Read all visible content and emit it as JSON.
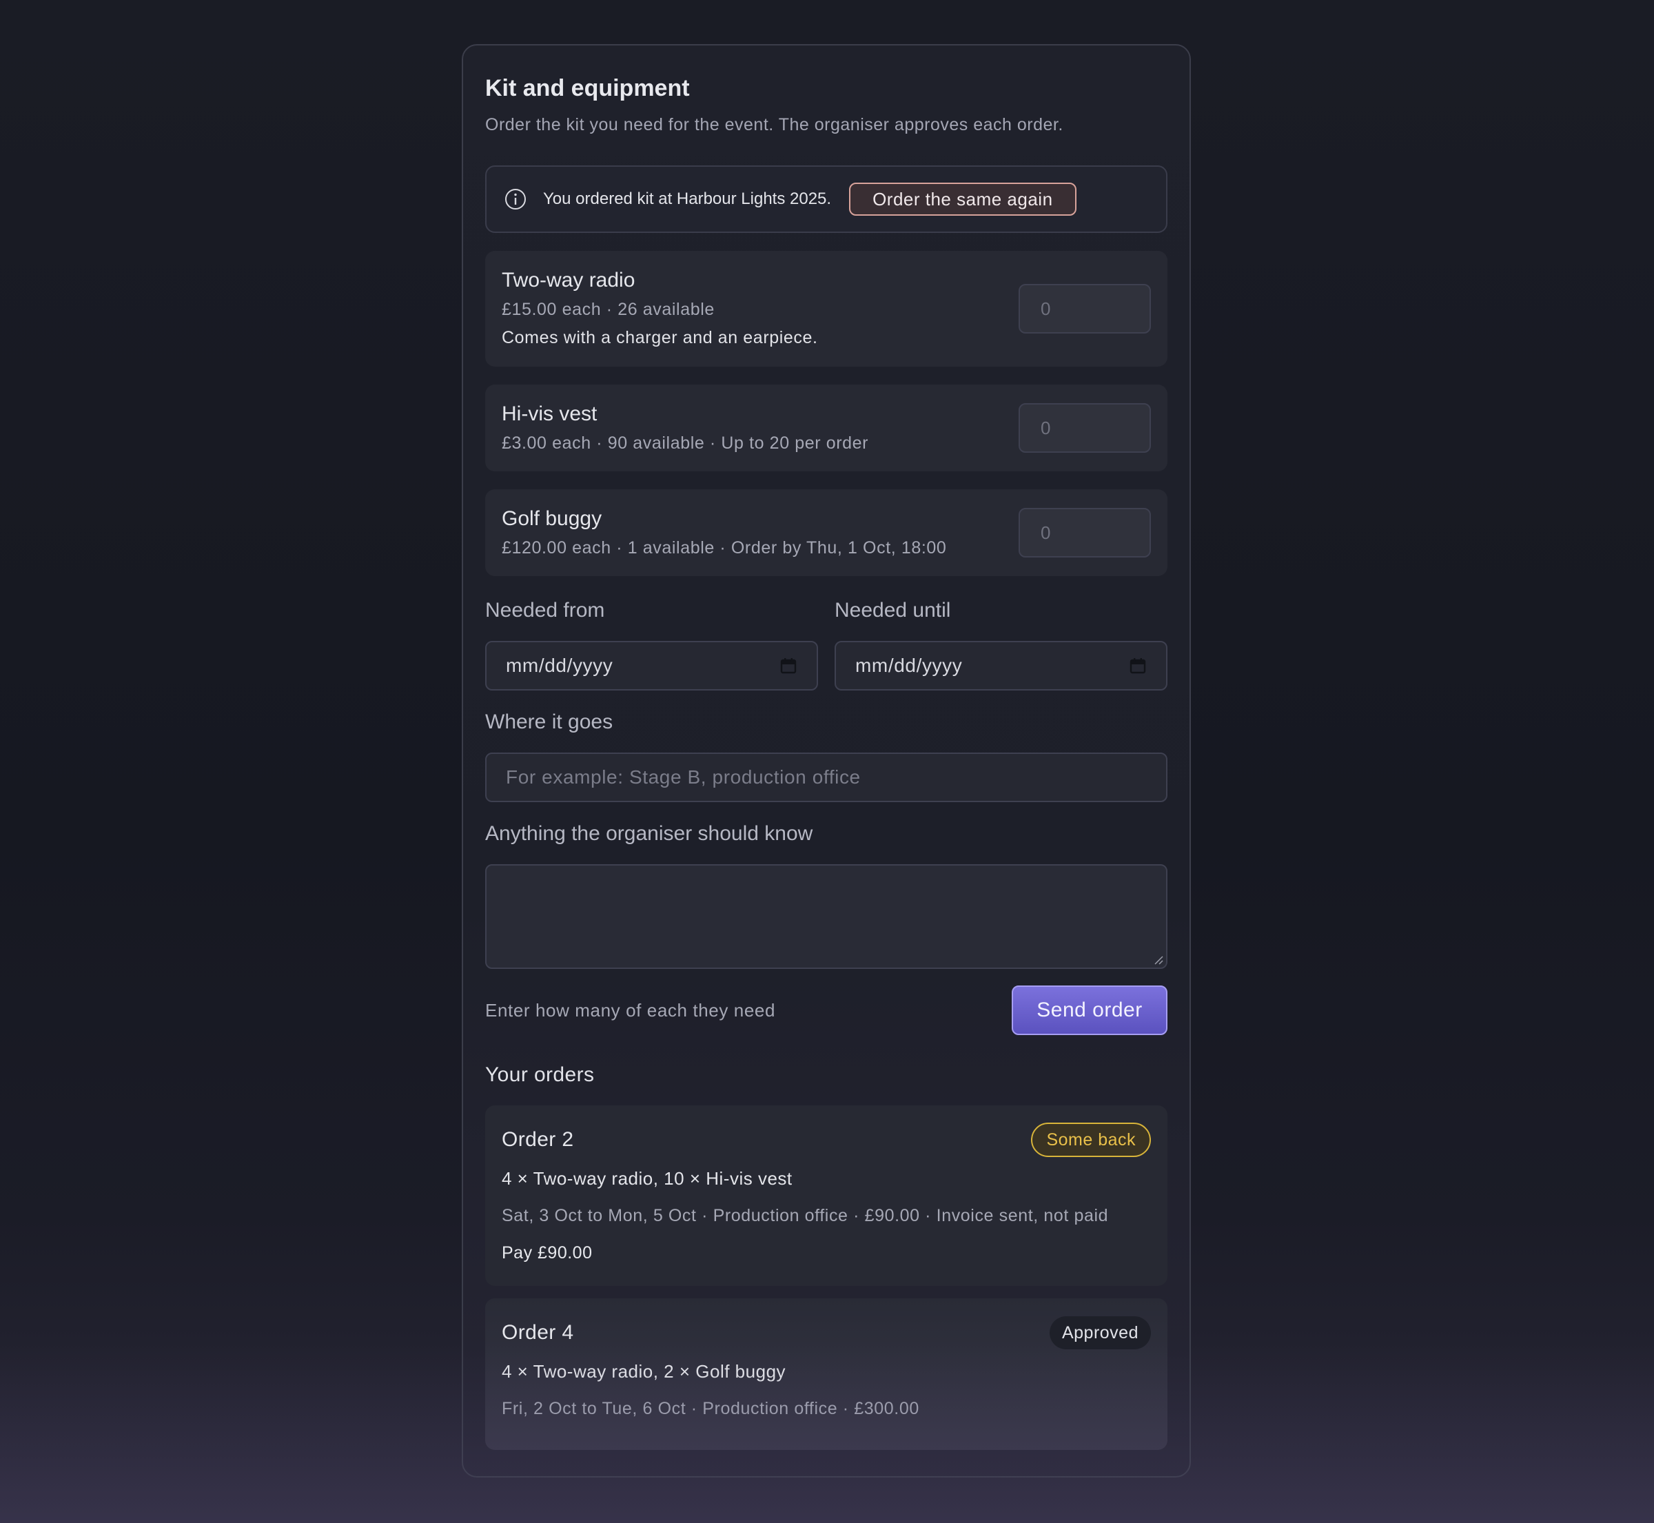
{
  "header": {
    "title": "Kit and equipment",
    "subtitle": "Order the kit you need for the event. The organiser approves each order."
  },
  "notice": {
    "icon": "info-icon",
    "text": "You ordered kit at Harbour Lights 2025.",
    "button_label": "Order the same again"
  },
  "items": [
    {
      "name": "Two-way radio",
      "meta": "£15.00 each · 26 available",
      "description": "Comes with a charger and an earpiece.",
      "quantity_placeholder": "0"
    },
    {
      "name": "Hi-vis vest",
      "meta": "£3.00 each · 90 available · Up to 20 per order",
      "quantity_placeholder": "0"
    },
    {
      "name": "Golf buggy",
      "meta": "£120.00 each · 1 available · Order by Thu, 1 Oct, 18:00",
      "quantity_placeholder": "0"
    }
  ],
  "form": {
    "needed_from_label": "Needed from",
    "needed_from_value": "mm/dd/yyyy",
    "needed_until_label": "Needed until",
    "needed_until_value": "mm/dd/yyyy",
    "location_label": "Where it goes",
    "location_placeholder": "For example: Stage B, production office",
    "notes_label": "Anything the organiser should know",
    "notes_value": "",
    "hint": "Enter how many of each they need",
    "send_label": "Send order"
  },
  "orders": {
    "heading": "Your orders",
    "list": [
      {
        "title": "Order 2",
        "status": "Some back",
        "items": "4 × Two-way radio, 10 × Hi-vis vest",
        "meta": "Sat, 3 Oct to Mon, 5 Oct · Production office · £90.00 · Invoice sent, not paid",
        "pay_label": "Pay £90.00"
      },
      {
        "title": "Order 4",
        "status": "Approved",
        "items": "4 × Two-way radio, 2 × Golf buggy",
        "meta": "Fri, 2 Oct to Tue, 6 Oct · Production office · £300.00"
      }
    ]
  },
  "colors": {
    "accent": "#6b62d0",
    "warning": "#e9c04a",
    "reorder_border": "#d8a39b"
  }
}
